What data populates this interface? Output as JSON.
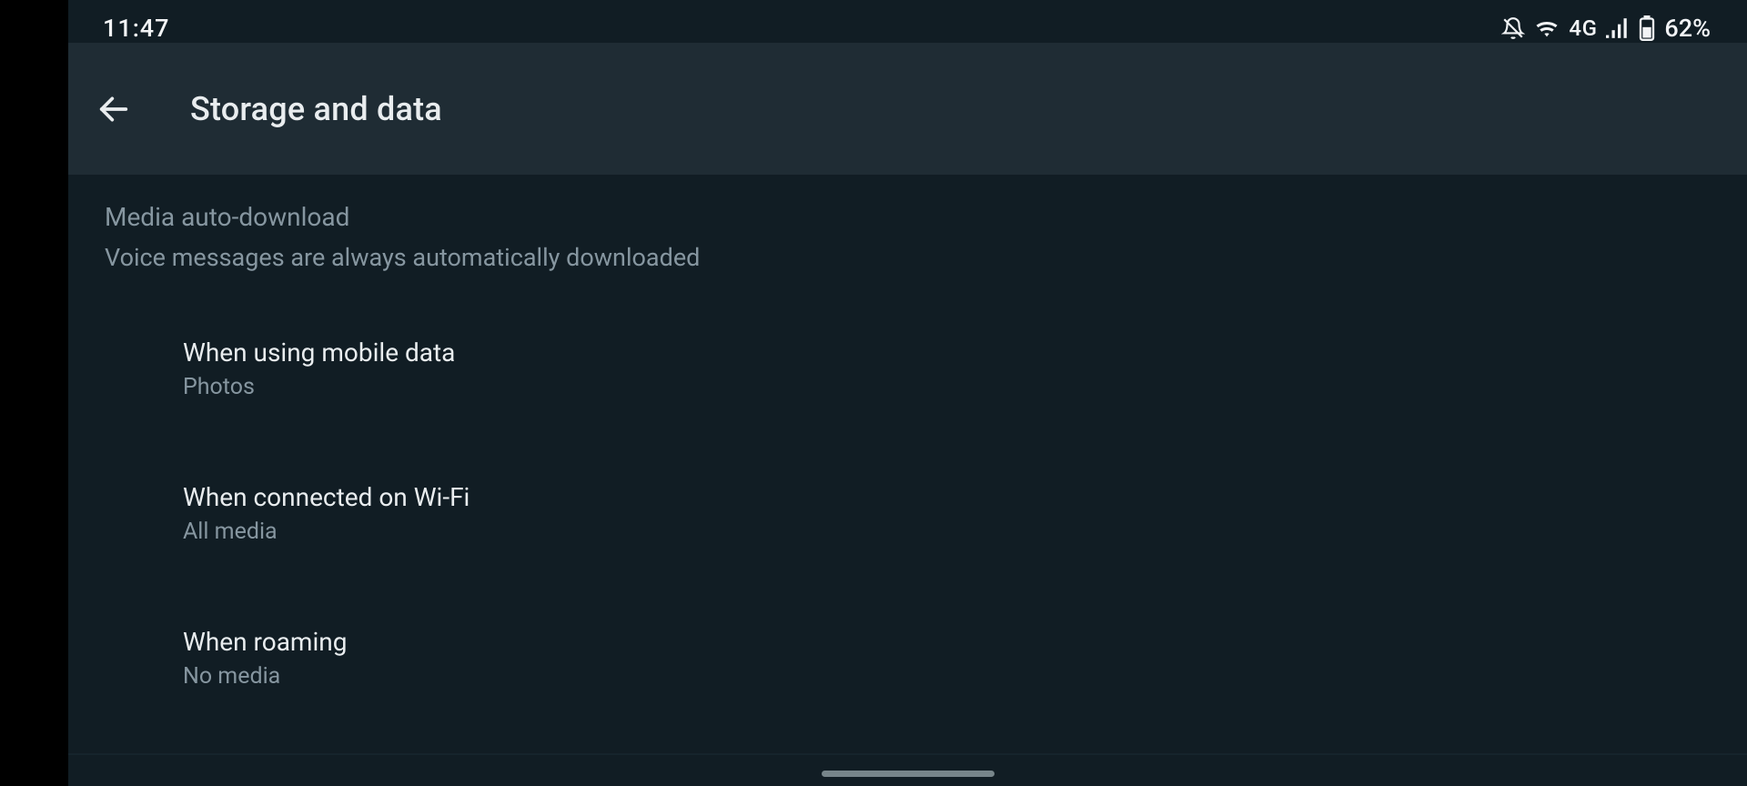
{
  "status": {
    "time": "11:47",
    "network_type": "4G",
    "battery_pct": "62%"
  },
  "appbar": {
    "title": "Storage and data"
  },
  "section": {
    "title": "Media auto-download",
    "subtitle": "Voice messages are always automatically downloaded"
  },
  "items": [
    {
      "title": "When using mobile data",
      "subtitle": "Photos"
    },
    {
      "title": "When connected on Wi-Fi",
      "subtitle": "All media"
    },
    {
      "title": "When roaming",
      "subtitle": "No media"
    }
  ]
}
